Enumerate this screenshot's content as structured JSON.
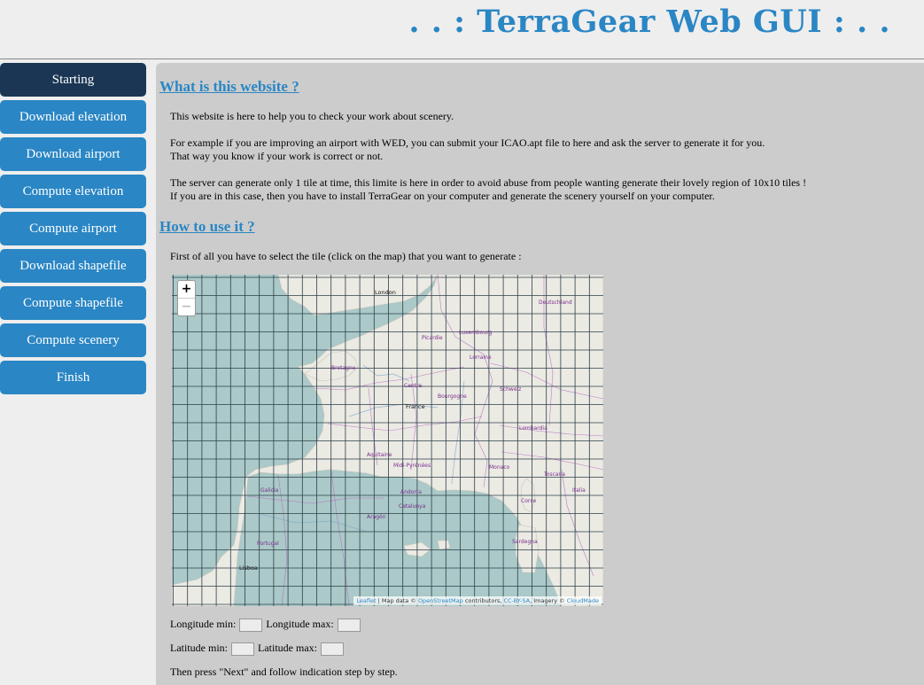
{
  "header": {
    "title": ". . : TerraGear Web GUI : . ."
  },
  "sidebar": {
    "items": [
      {
        "label": "Starting",
        "active": true
      },
      {
        "label": "Download elevation"
      },
      {
        "label": "Download airport"
      },
      {
        "label": "Compute elevation"
      },
      {
        "label": "Compute airport"
      },
      {
        "label": "Download shapefile"
      },
      {
        "label": "Compute shapefile"
      },
      {
        "label": "Compute scenery"
      },
      {
        "label": "Finish"
      }
    ]
  },
  "main": {
    "section1": {
      "heading": "What is this website ?",
      "p1": "This website is here to help you to check your work about scenery.",
      "p2a": "For example if you are improving an airport with WED, you can submit your ICAO.apt file to here and ask the server to generate it for you.",
      "p2b": "That way you know if your work is correct or not.",
      "p3a": "The server can generate only 1 tile at time, this limite is here in order to avoid abuse from people wanting generate their lovely region of 10x10 tiles !",
      "p3b": "If you are in this case, then you have to install TerraGear on your computer and generate the scenery yourself on your computer."
    },
    "section2": {
      "heading": "How to use it ?",
      "p1": "First of all you have to select the tile (click on the map) that you want to generate :"
    },
    "map": {
      "zoom_in": "+",
      "zoom_out": "−",
      "attribution": {
        "leaflet": "Leaflet",
        "text1": " | Map data © ",
        "osm": "OpenStreetMap",
        "text2": " contributors, ",
        "license": "CC-BY-SA",
        "text3": ", Imagery © ",
        "provider": "CloudMade"
      },
      "labels": {
        "london": "London",
        "lisboa": "Lisboa",
        "deutschland": "Deutschland",
        "france": "France",
        "luxembourg": "Luxembourg",
        "centre": "Centre",
        "bretagne": "Bretagne",
        "picardie": "Picardie",
        "lorraine": "Lorraine",
        "bourgogne": "Bourgogne",
        "aquitaine": "Aquitaine",
        "midi": "Midi-Pyrénées",
        "galicia": "Galicia",
        "aragon": "Aragón",
        "catalunya": "Catalunya",
        "andorra": "Andorra",
        "corse": "Corse",
        "sardegna": "Sardegna",
        "portugal": "Portugal",
        "italia": "Italia",
        "monaco": "Monaco",
        "schweiz": "Schweiz",
        "lombardia": "Lombardia",
        "toscana": "Toscana"
      },
      "colors": {
        "sea": "#aac9c8",
        "land": "#ebeae3",
        "grid": "#2d3f4a",
        "border": "#b768c4"
      }
    },
    "form": {
      "lon_min_label": "Longitude min:",
      "lon_max_label": "Longitude max:",
      "lat_min_label": "Latitude min:",
      "lat_max_label": "Latitude max:",
      "lon_min": "",
      "lon_max": "",
      "lat_min": "",
      "lat_max": ""
    },
    "footer_text": "Then press \"Next\" and follow indication step by step."
  }
}
